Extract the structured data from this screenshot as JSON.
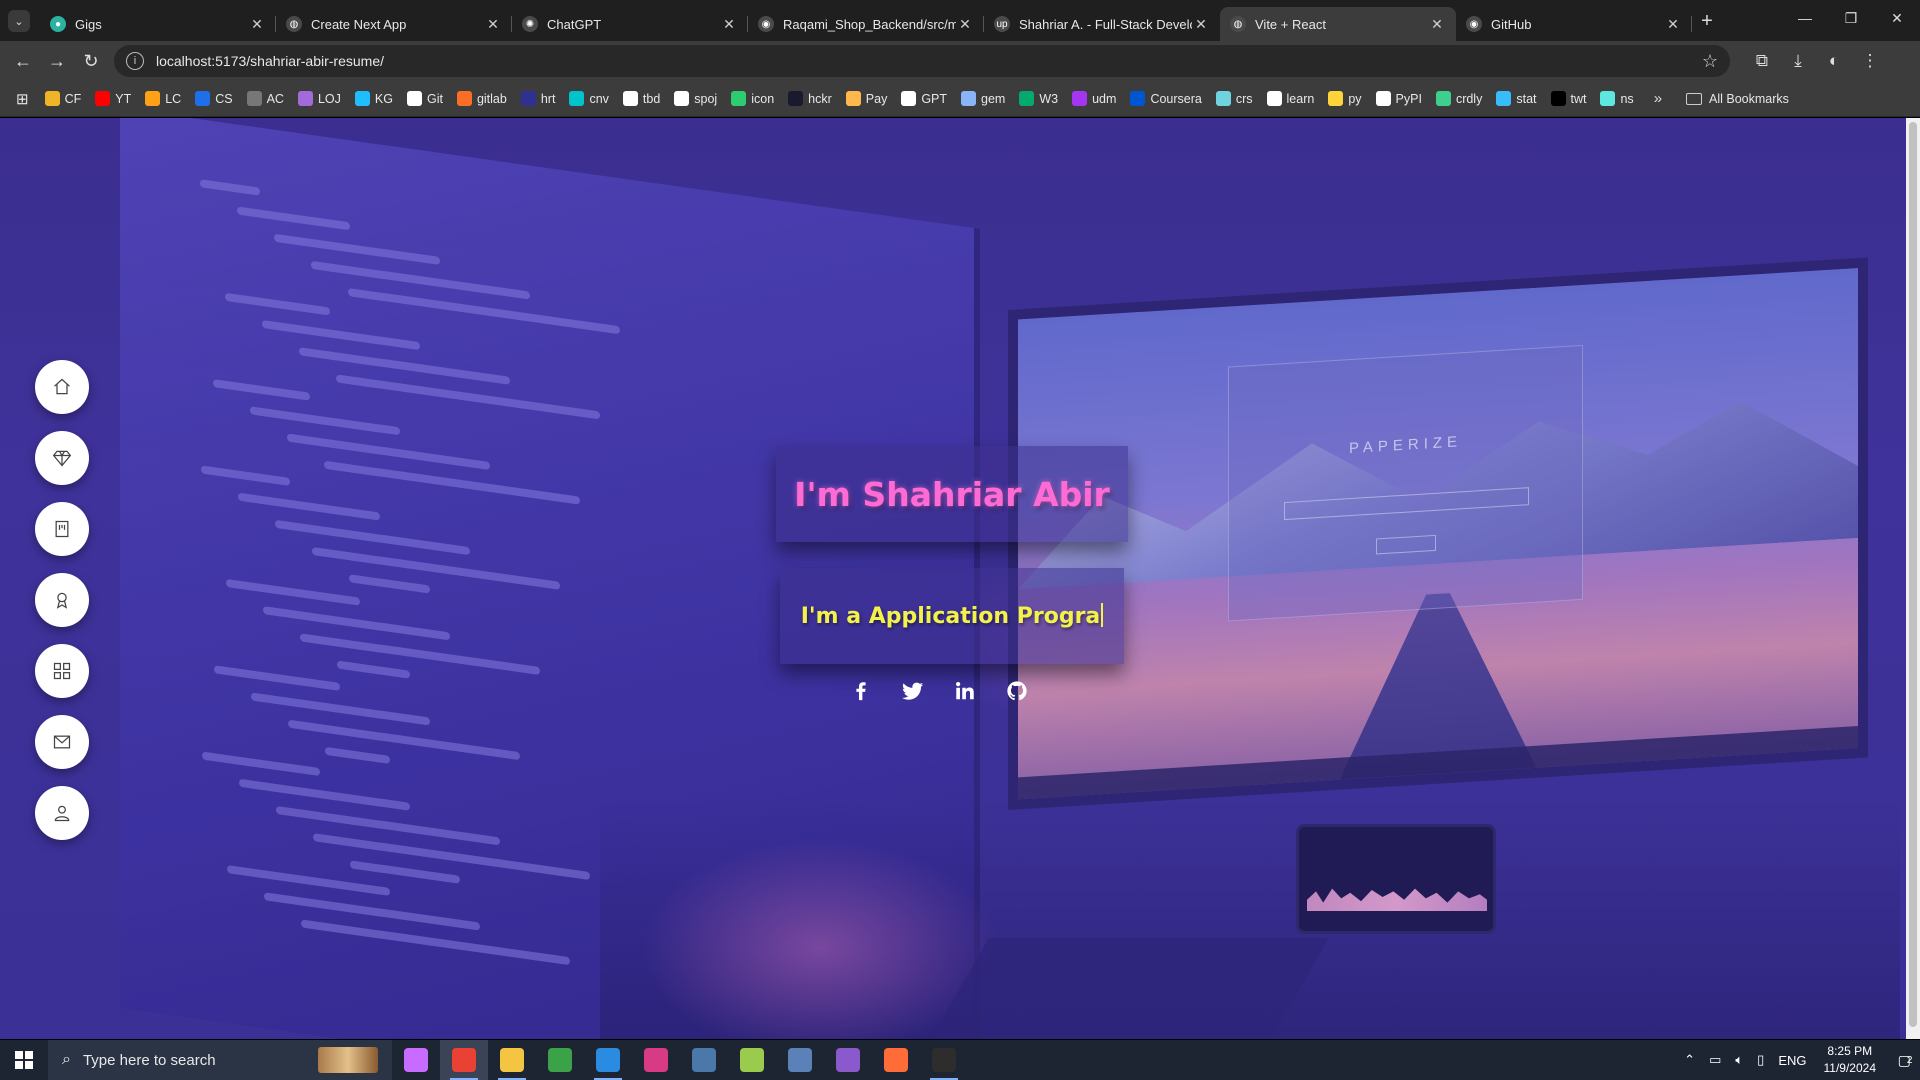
{
  "tabs": [
    {
      "title": "Gigs",
      "fav": "#2bb3a0",
      "glyph": "●"
    },
    {
      "title": "Create Next App",
      "fav": "#4a4a4a",
      "glyph": "◍"
    },
    {
      "title": "ChatGPT",
      "fav": "#4a4a4a",
      "glyph": "✺"
    },
    {
      "title": "Raqami_Shop_Backend/src/mai",
      "fav": "#4a4a4a",
      "glyph": "◉"
    },
    {
      "title": "Shahriar A. - Full-Stack Develop",
      "fav": "#4a4a4a",
      "glyph": "up"
    },
    {
      "title": "Vite + React",
      "fav": "#4a4a4a",
      "glyph": "◍"
    },
    {
      "title": "GitHub",
      "fav": "#4a4a4a",
      "glyph": "◉"
    }
  ],
  "new_tab_label": "+",
  "window_controls": {
    "minimize": "—",
    "restore": "❐",
    "close": "✕"
  },
  "address_bar": {
    "url": "localhost:5173/shahriar-abir-resume/"
  },
  "bookmarks": [
    {
      "label": "CF",
      "color": "#f0b429"
    },
    {
      "label": "YT",
      "color": "#ff0000"
    },
    {
      "label": "LC",
      "color": "#ffa116"
    },
    {
      "label": "CS",
      "color": "#1f6feb"
    },
    {
      "label": "AC",
      "color": "#777777"
    },
    {
      "label": "LOJ",
      "color": "#a36ad9"
    },
    {
      "label": "KG",
      "color": "#20beff"
    },
    {
      "label": "Git",
      "color": "#ffffff"
    },
    {
      "label": "gitlab",
      "color": "#fc6d26"
    },
    {
      "label": "hrt",
      "color": "#2e3192"
    },
    {
      "label": "cnv",
      "color": "#00c4cc"
    },
    {
      "label": "tbd",
      "color": "#ffffff"
    },
    {
      "label": "spoj",
      "color": "#ffffff"
    },
    {
      "label": "icon",
      "color": "#2ecc71"
    },
    {
      "label": "hckr",
      "color": "#1a1a2e"
    },
    {
      "label": "Pay",
      "color": "#ffb84d"
    },
    {
      "label": "GPT",
      "color": "#ffffff"
    },
    {
      "label": "gem",
      "color": "#8ab4f8"
    },
    {
      "label": "W3",
      "color": "#04aa6d"
    },
    {
      "label": "udm",
      "color": "#a435f0"
    },
    {
      "label": "Coursera",
      "color": "#0056d2"
    },
    {
      "label": "crs",
      "color": "#6fd3e0"
    },
    {
      "label": "learn",
      "color": "#ffffff"
    },
    {
      "label": "py",
      "color": "#ffd43b"
    },
    {
      "label": "PyPI",
      "color": "#ffffff"
    },
    {
      "label": "crdly",
      "color": "#3ecf8e"
    },
    {
      "label": "stat",
      "color": "#38bdf8"
    },
    {
      "label": "twt",
      "color": "#000000"
    },
    {
      "label": "ns",
      "color": "#5ee7df"
    }
  ],
  "bookmarks_overflow": "»",
  "all_bookmarks_label": "All Bookmarks",
  "hero": {
    "name": "I'm Shahriar Abir",
    "role": "I'm a Application Progra"
  },
  "side_nav": [
    "home-icon",
    "diamond-icon",
    "resume-icon",
    "award-icon",
    "grid-icon",
    "mail-icon",
    "user-icon"
  ],
  "socials": [
    "facebook-icon",
    "twitter-icon",
    "linkedin-icon",
    "github-icon"
  ],
  "taskbar": {
    "search_placeholder": "Type here to search",
    "apps": [
      {
        "name": "copilot-app",
        "color": "#c86bff"
      },
      {
        "name": "chrome-app",
        "color": "#e94235",
        "running": true,
        "active": true
      },
      {
        "name": "file-explorer-app",
        "color": "#f4c542",
        "running": true
      },
      {
        "name": "store-app",
        "color": "#3aa34a"
      },
      {
        "name": "vscode-app",
        "color": "#2b8be0",
        "running": true
      },
      {
        "name": "intellij-app",
        "color": "#d93a86"
      },
      {
        "name": "mysql-workbench-app",
        "color": "#4a78a8"
      },
      {
        "name": "tool-app",
        "color": "#9bcb4c"
      },
      {
        "name": "postgres-app",
        "color": "#5a82b8"
      },
      {
        "name": "visual-studio-app",
        "color": "#8a5acd"
      },
      {
        "name": "postman-app",
        "color": "#ff6c37"
      },
      {
        "name": "terminal-app",
        "color": "#2d2d2d",
        "running": true
      }
    ],
    "language": "ENG",
    "time": "8:25 PM",
    "date": "11/9/2024",
    "notification_count": "2"
  },
  "colors": {
    "page_bg": "#3c2f8c",
    "name_pink": "#ff6ad5",
    "role_yellow": "#f2f24a"
  }
}
